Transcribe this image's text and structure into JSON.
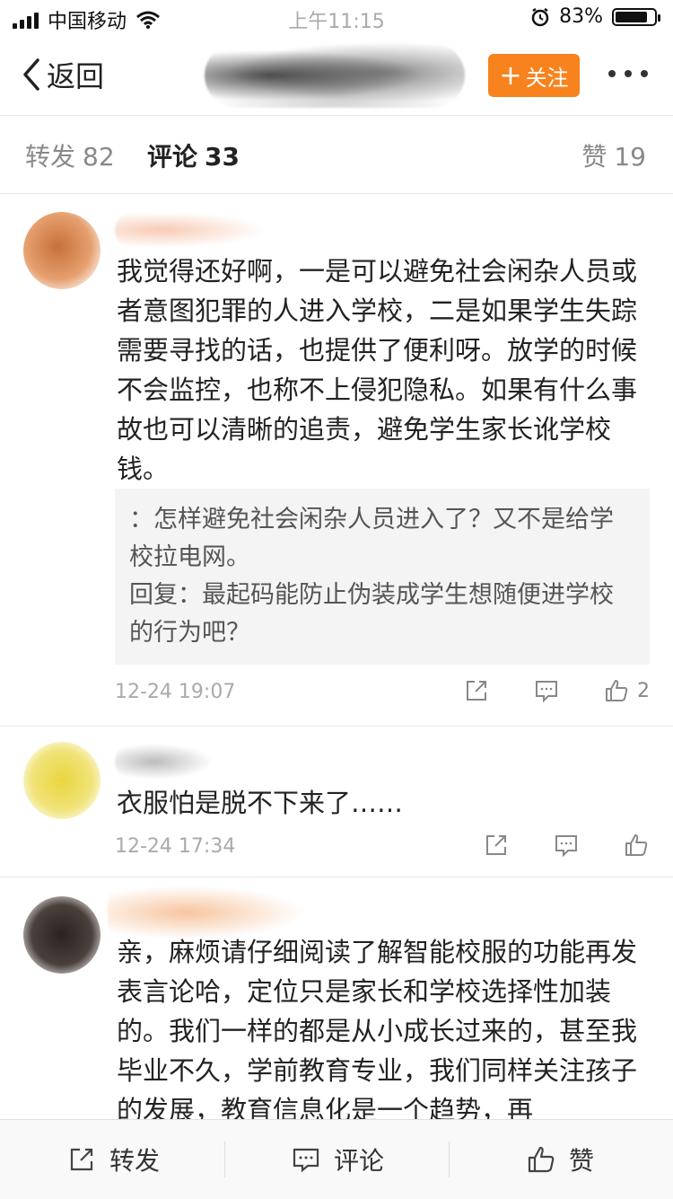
{
  "status_bar": {
    "carrier": "中国移动",
    "time": "上午11:15",
    "battery_percent": "83%",
    "battery_level": 0.83
  },
  "nav": {
    "back_label": "返回",
    "follow_label": "关注",
    "follow_plus": "+"
  },
  "tabs": [
    {
      "label": "转发",
      "count": "82"
    },
    {
      "label": "评论",
      "count": "33"
    },
    {
      "label": "赞",
      "count": "19"
    }
  ],
  "comments": [
    {
      "text": "我觉得还好啊，一是可以避免社会闲杂人员或者意图犯罪的人进入学校，二是如果学生失踪需要寻找的话，也提供了便利呀。放学的时候不会监控，也称不上侵犯隐私。如果有什么事故也可以清晰的追责，避免学生家长讹学校钱。",
      "replies": [
        "：怎样避免社会闲杂人员进入了？又不是给学校拉电网。",
        "回复：最起码能防止伪装成学生想随便进学校的行为吧？"
      ],
      "time": "12-24 19:07",
      "likes": "2"
    },
    {
      "text": "衣服怕是脱不下来了……",
      "time": "12-24 17:34",
      "likes": ""
    },
    {
      "text": "亲，麻烦请仔细阅读了解智能校服的功能再发表言论哈，定位只是家长和学校选择性加装的。我们一样的都是从小成长过来的，甚至我毕业不久，学前教育专业，我们同样关注孩子的发展，教育信息化是一个趋势，再"
    }
  ],
  "bottom_bar": {
    "repost": "转发",
    "comment": "评论",
    "like": "赞"
  },
  "colors": {
    "follow_button": "#f8821d",
    "secondary_text": "#888888",
    "reply_background": "#f4f4f4"
  }
}
